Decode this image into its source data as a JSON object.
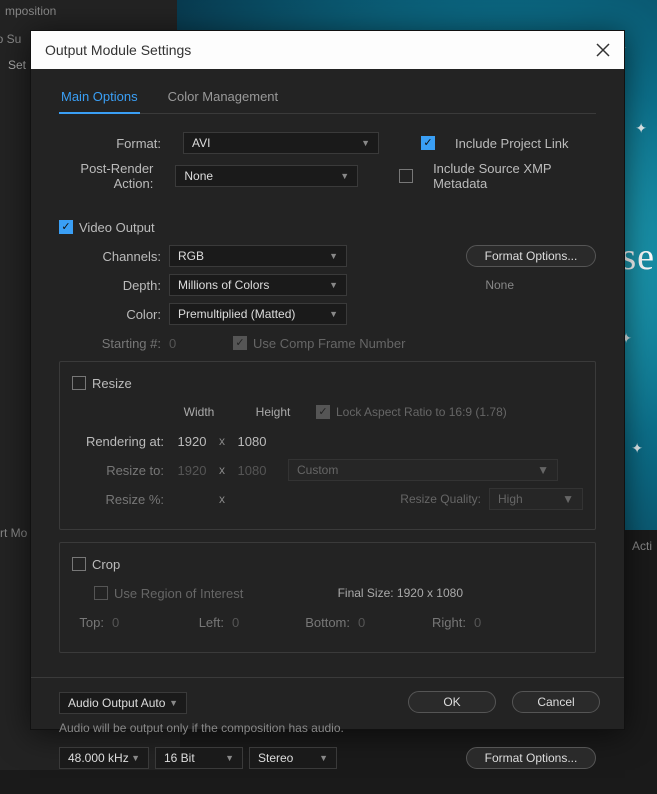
{
  "bg": {
    "composition": "mposition",
    "sub": "lo Su",
    "set": "Set",
    "bigtext": "se",
    "mo": "rt Mo",
    "act": "Acti"
  },
  "dialog": {
    "title": "Output Module Settings",
    "tabs": {
      "main": "Main Options",
      "color": "Color Management"
    },
    "format": {
      "label": "Format:",
      "value": "AVI"
    },
    "post_render": {
      "label": "Post-Render Action:",
      "value": "None"
    },
    "include_link": "Include Project Link",
    "include_xmp": "Include Source XMP Metadata",
    "video_output": "Video Output",
    "channels": {
      "label": "Channels:",
      "value": "RGB"
    },
    "depth": {
      "label": "Depth:",
      "value": "Millions of Colors"
    },
    "color": {
      "label": "Color:",
      "value": "Premultiplied (Matted)"
    },
    "starting": {
      "label": "Starting #:",
      "value": "0"
    },
    "use_comp": "Use Comp Frame Number",
    "format_options": "Format Options...",
    "none_text": "None",
    "resize": {
      "title": "Resize",
      "width": "Width",
      "height": "Height",
      "lock": "Lock Aspect Ratio to 16:9 (1.78)",
      "rendering_at": "Rendering at:",
      "rw": "1920",
      "rh": "1080",
      "resize_to": "Resize to:",
      "tw": "1920",
      "th": "1080",
      "custom": "Custom",
      "resize_pct": "Resize %:",
      "quality_label": "Resize Quality:",
      "quality_value": "High"
    },
    "crop": {
      "title": "Crop",
      "roi": "Use Region of Interest",
      "final": "Final Size: 1920 x 1080",
      "top": "Top:",
      "left": "Left:",
      "bottom": "Bottom:",
      "right": "Right:",
      "v": "0"
    },
    "audio": {
      "mode": "Audio Output Auto",
      "note": "Audio will be output only if the composition has audio.",
      "rate": "48.000 kHz",
      "bit": "16 Bit",
      "ch": "Stereo",
      "format_options": "Format Options..."
    },
    "ok": "OK",
    "cancel": "Cancel"
  }
}
